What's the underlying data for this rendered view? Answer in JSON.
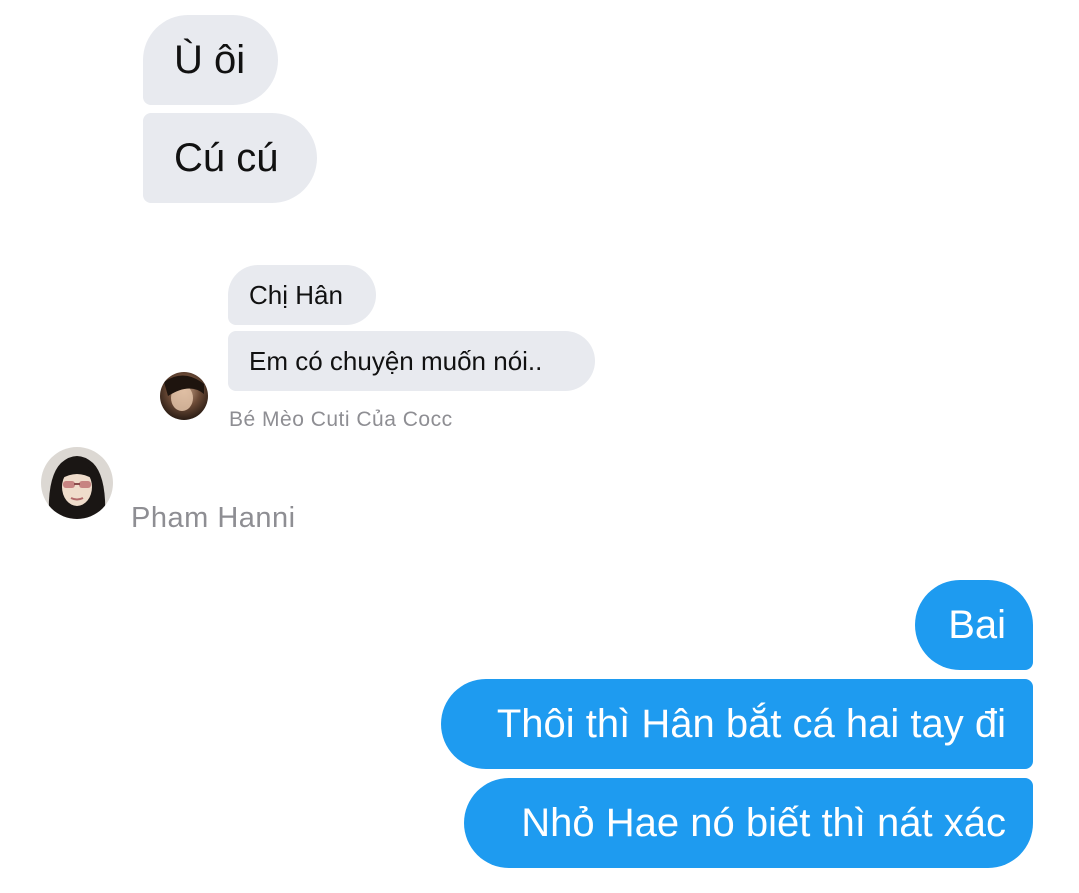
{
  "conversation": {
    "quoted_top": [
      {
        "text": "Ù ôi"
      },
      {
        "text": "Cú cú"
      }
    ],
    "quoted_nested": {
      "messages": [
        {
          "text": "Chị Hân"
        },
        {
          "text": "Em có chuyện muốn nói.."
        }
      ],
      "sender_name": "Bé Mèo Cuti Của Cocc",
      "avatar_icon": "profile-photo-icon"
    },
    "incoming_sender": {
      "name": "Pham Hanni",
      "avatar_icon": "profile-photo-icon"
    },
    "outgoing": [
      {
        "text": "Bai"
      },
      {
        "text": "Thôi thì Hân bắt cá hai tay đi"
      },
      {
        "text": "Nhỏ Hae nó biết thì nát xác"
      }
    ]
  },
  "colors": {
    "incoming_bubble": "#e8eaef",
    "outgoing_bubble": "#1e9bf0",
    "sender_name": "#8e8e93",
    "background": "#ffffff"
  }
}
